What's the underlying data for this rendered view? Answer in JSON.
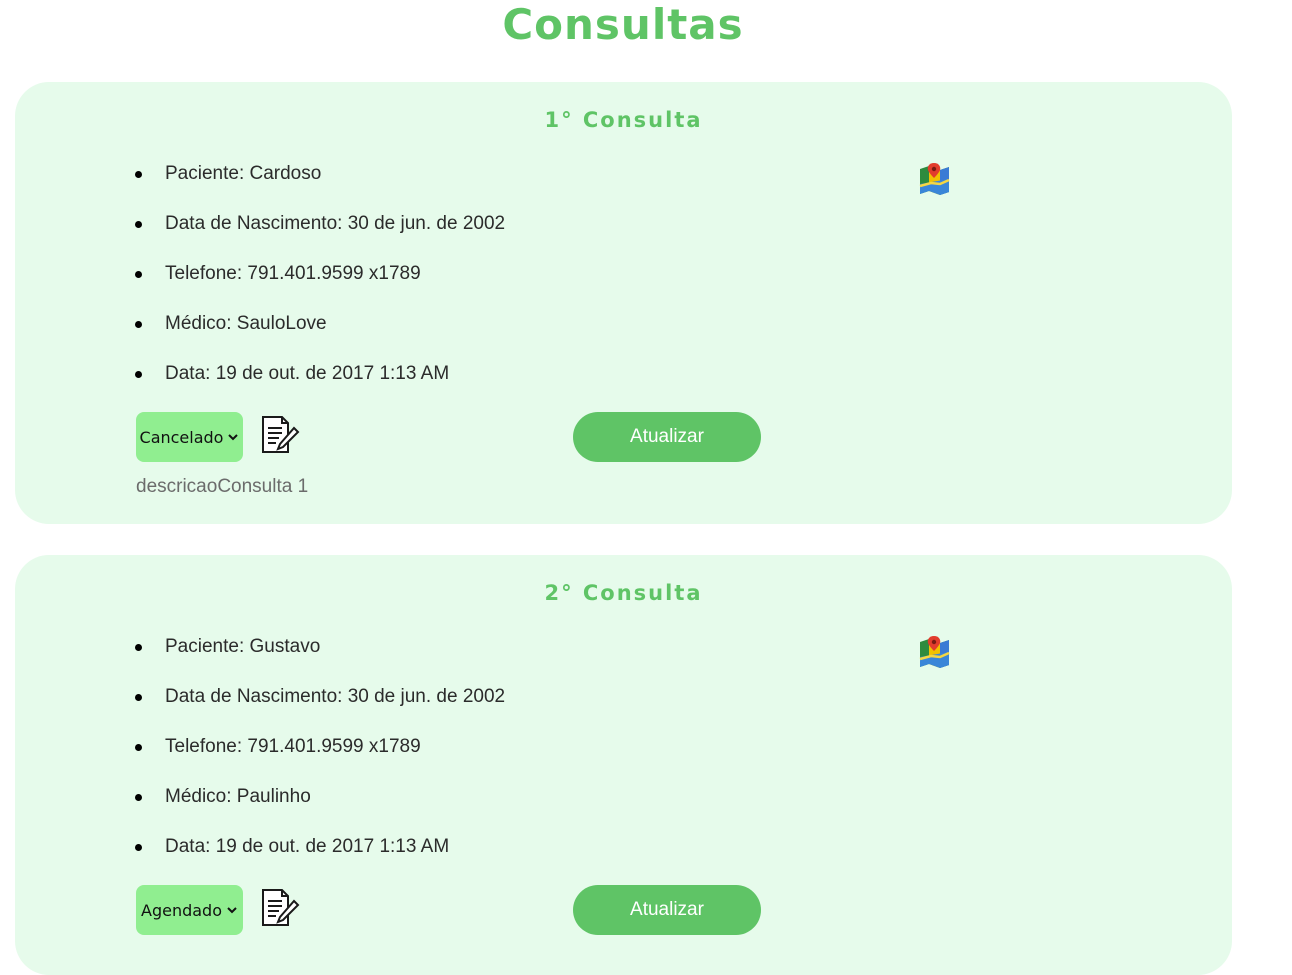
{
  "page": {
    "title": "Consultas"
  },
  "consultas": [
    {
      "title": "1° Consulta",
      "info": [
        "Paciente: Cardoso",
        "Data de Nascimento: 30 de jun. de 2002",
        "Telefone: 791.401.9599 x1789",
        "Médico: SauloLove",
        "Data: 19 de out. de 2017 1:13 AM"
      ],
      "status": "Cancelado",
      "update_label": "Atualizar",
      "description": "descricaoConsulta 1",
      "icons": {
        "map": "map-pin-icon",
        "edit": "edit-document-icon"
      }
    },
    {
      "title": "2° Consulta",
      "info": [
        "Paciente: Gustavo",
        "Data de Nascimento: 30 de jun. de 2002",
        "Telefone: 791.401.9599 x1789",
        "Médico: Paulinho",
        "Data: 19 de out. de 2017 1:13 AM"
      ],
      "status": "Agendado",
      "update_label": "Atualizar",
      "icons": {
        "map": "map-pin-icon",
        "edit": "edit-document-icon"
      }
    }
  ],
  "colors": {
    "accent": "#5fc466",
    "card_background": "#e6fbeb",
    "select_background": "#90ee90"
  }
}
